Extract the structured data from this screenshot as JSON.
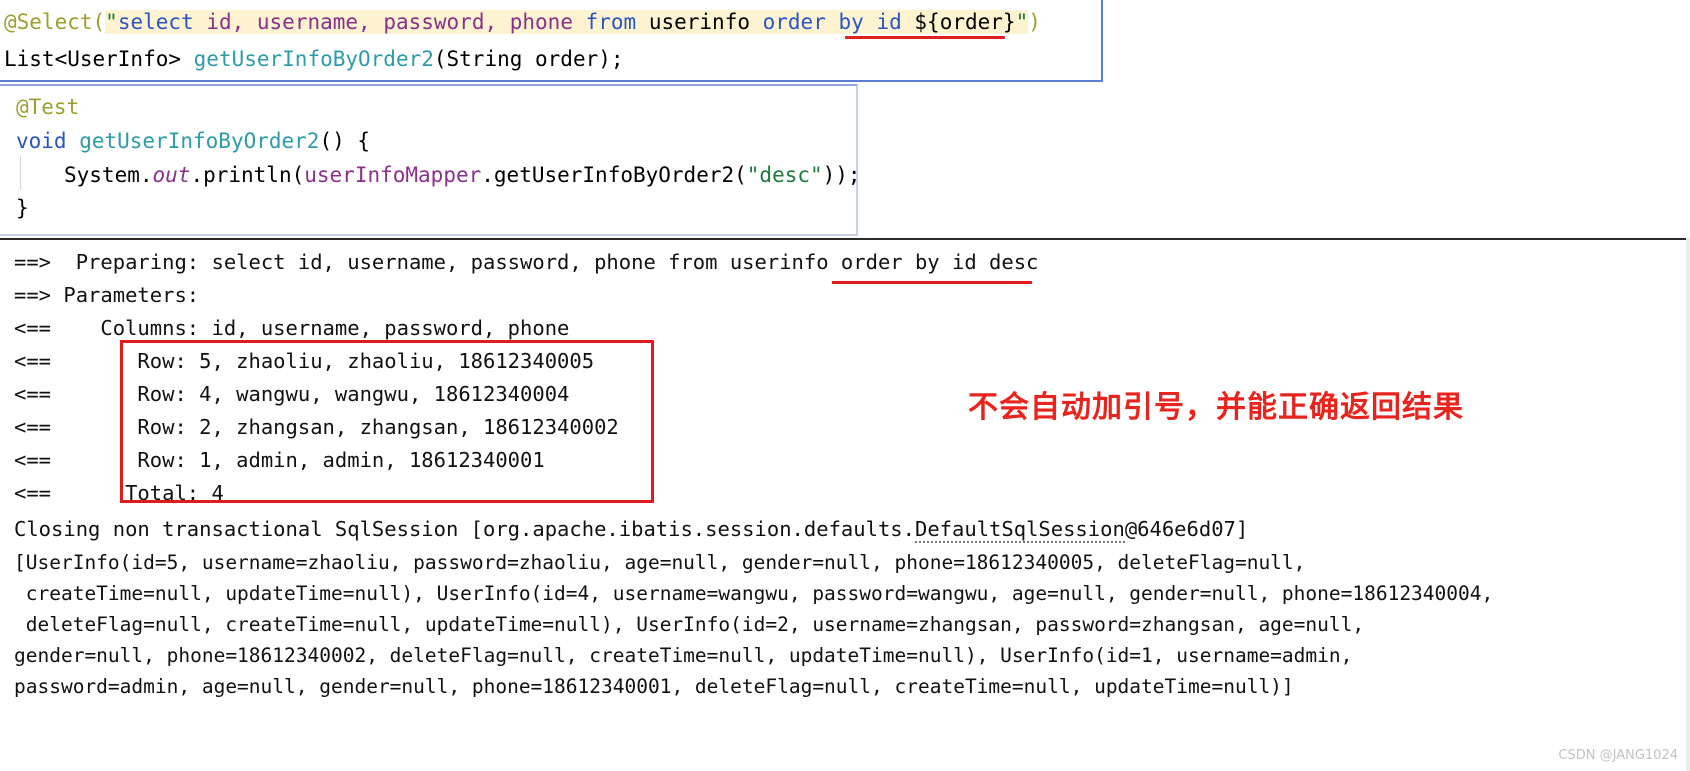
{
  "mapper_snippet": {
    "annotation_name": "@Select(",
    "sql_text": "\"select id, username, password, phone from userinfo order by id ${order}\"",
    "sql_parts": {
      "quote_open": "\"",
      "kw_select": "select",
      "cols": " id, username, password, phone ",
      "kw_from": "from",
      "table": " userinfo ",
      "kw_order": "order",
      "kw_by": "by",
      "col_id": "id",
      "placeholder": "${order}",
      "quote_close": "\""
    },
    "paren_close": ")",
    "signature": "List<UserInfo> getUserInfoByOrder2(String order);",
    "signature_parts": {
      "type": "List<UserInfo> ",
      "method": "getUserInfoByOrder2",
      "args": "(String order);"
    }
  },
  "test_snippet": {
    "annotation": "@Test",
    "line_signature_kw": "void",
    "line_signature_method": " getUserInfoByOrder2",
    "line_signature_tail": "() {",
    "body_system": "System.",
    "body_out": "out",
    "body_println": ".println(",
    "body_mapper": "userInfoMapper",
    "body_call": ".getUserInfoByOrder2(",
    "body_arg": "\"desc\"",
    "body_tail": "));",
    "closing_brace": "}"
  },
  "console": {
    "lines": [
      "==>  Preparing: select id, username, password, phone from userinfo order by id desc",
      "==> Parameters: ",
      "<==    Columns: id, username, password, phone",
      "<==       Row: 5, zhaoliu, zhaoliu, 18612340005",
      "<==       Row: 4, wangwu, wangwu, 18612340004",
      "<==       Row: 2, zhangsan, zhangsan, 18612340002",
      "<==       Row: 1, admin, admin, 18612340001",
      "<==      Total: 4"
    ],
    "closing_prefix": "Closing non transactional SqlSession [org.apache.ibatis.session.defaults.",
    "closing_link": "DefaultSqlSession",
    "closing_suffix": "@646e6d07]",
    "result_lines": [
      "[UserInfo(id=5, username=zhaoliu, password=zhaoliu, age=null, gender=null, phone=18612340005, deleteFlag=null,",
      " createTime=null, updateTime=null), UserInfo(id=4, username=wangwu, password=wangwu, age=null, gender=null, phone=18612340004,",
      " deleteFlag=null, createTime=null, updateTime=null), UserInfo(id=2, username=zhangsan, password=zhangsan, age=null,",
      "gender=null, phone=18612340002, deleteFlag=null, createTime=null, updateTime=null), UserInfo(id=1, username=admin,",
      "password=admin, age=null, gender=null, phone=18612340001, deleteFlag=null, createTime=null, updateTime=null)]"
    ]
  },
  "annotations": {
    "chinese_note": "不会自动加引号，并能正确返回结果",
    "note_color": "#e8241f",
    "box_color": "#e11b1b"
  },
  "watermark": "CSDN @JANG1024"
}
